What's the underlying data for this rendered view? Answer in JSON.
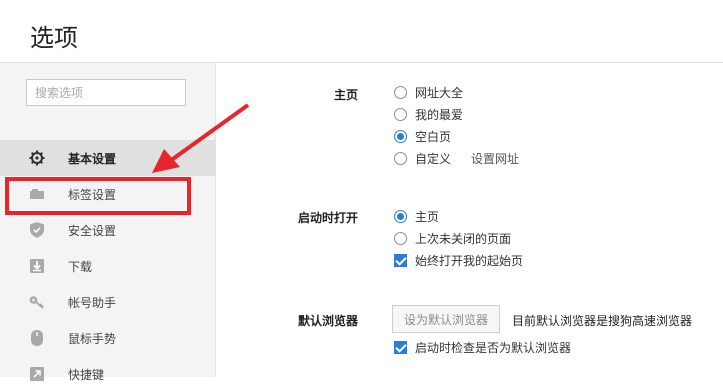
{
  "header": {
    "title": "选项"
  },
  "sidebar": {
    "search_placeholder": "搜索选项",
    "items": [
      {
        "label": "基本设置",
        "icon": "gear-icon"
      },
      {
        "label": "标签设置",
        "icon": "tab-icon"
      },
      {
        "label": "安全设置",
        "icon": "shield-icon"
      },
      {
        "label": "下载",
        "icon": "download-icon"
      },
      {
        "label": "帐号助手",
        "icon": "key-icon"
      },
      {
        "label": "鼠标手势",
        "icon": "mouse-icon"
      },
      {
        "label": "快捷键",
        "icon": "shortcut-icon"
      }
    ]
  },
  "homepage": {
    "label": "主页",
    "options": [
      "网址大全",
      "我的最爱",
      "空白页",
      "自定义"
    ],
    "selected": "空白页",
    "set_url_link": "设置网址"
  },
  "startup": {
    "label": "启动时打开",
    "options": [
      "主页",
      "上次未关闭的页面"
    ],
    "selected": "主页",
    "checkbox_label": "始终打开我的起始页",
    "checkbox_checked": true
  },
  "default_browser": {
    "label": "默认浏览器",
    "button_label": "设为默认浏览器",
    "status_text": "目前默认浏览器是搜狗高速浏览器",
    "checkbox_label": "启动时检查是否为默认浏览器",
    "checkbox_checked": true
  },
  "colors": {
    "accent": "#2f7bd8",
    "highlight": "#e8252b"
  }
}
